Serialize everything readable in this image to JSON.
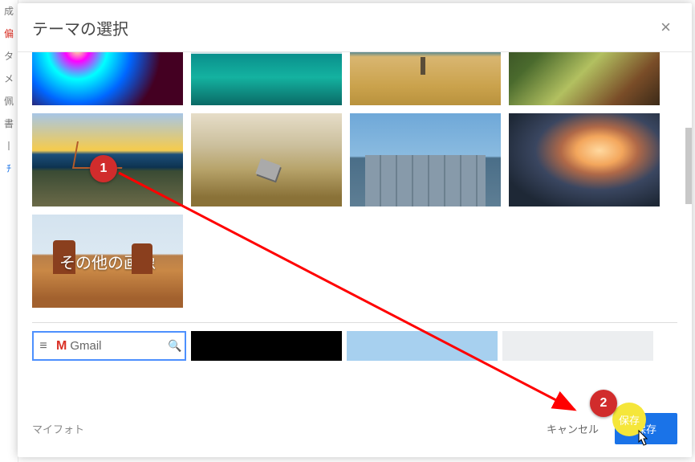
{
  "dialog": {
    "title": "テーマの選択",
    "close_icon": "×"
  },
  "themes": {
    "more_images_label": "その他の画像"
  },
  "preview": {
    "gmail_text": "Gmail",
    "menu_glyph": "≡",
    "m_glyph": "M",
    "search_glyph": "🔍"
  },
  "footer": {
    "my_photos": "マイフォト",
    "cancel": "キャンセル",
    "save": "保存"
  },
  "annotations": {
    "step1": "1",
    "step2": "2",
    "save_overlay": "保存"
  },
  "bg_sidebar": [
    "成",
    "偏",
    "タ",
    "メ",
    "佩",
    "書",
    "丨",
    "ﾁ"
  ]
}
